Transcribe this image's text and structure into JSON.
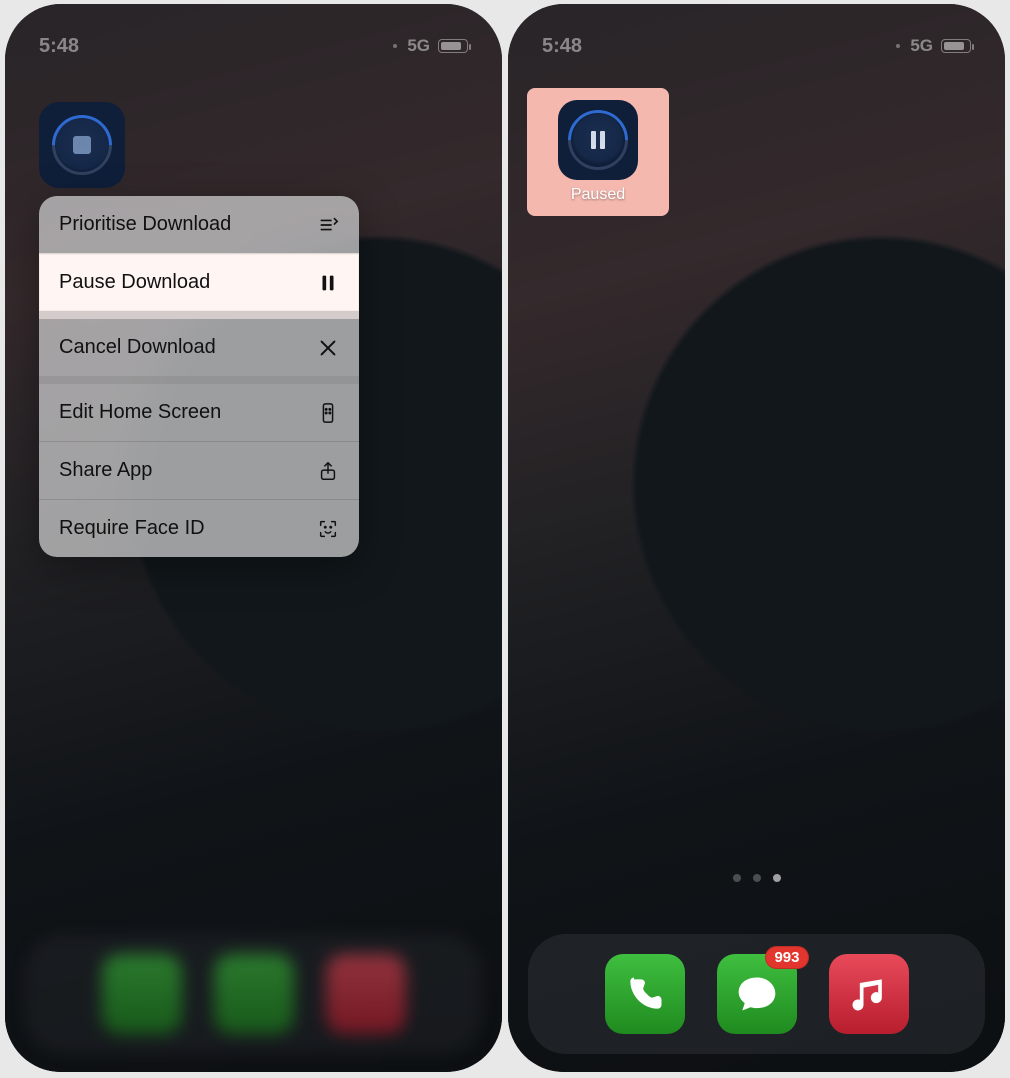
{
  "statusbar": {
    "time": "5:48",
    "network_label": "5G"
  },
  "context_menu": {
    "items": [
      {
        "label": "Prioritise Download",
        "icon": "priority"
      },
      {
        "label": "Pause Download",
        "icon": "pause",
        "highlight": true
      },
      {
        "label": "Cancel Download",
        "icon": "close"
      },
      {
        "label": "Edit Home Screen",
        "icon": "phone-edit"
      },
      {
        "label": "Share App",
        "icon": "share"
      },
      {
        "label": "Require Face ID",
        "icon": "faceid"
      }
    ]
  },
  "paused_app": {
    "label": "Paused"
  },
  "dock": {
    "messages_badge": "993"
  }
}
